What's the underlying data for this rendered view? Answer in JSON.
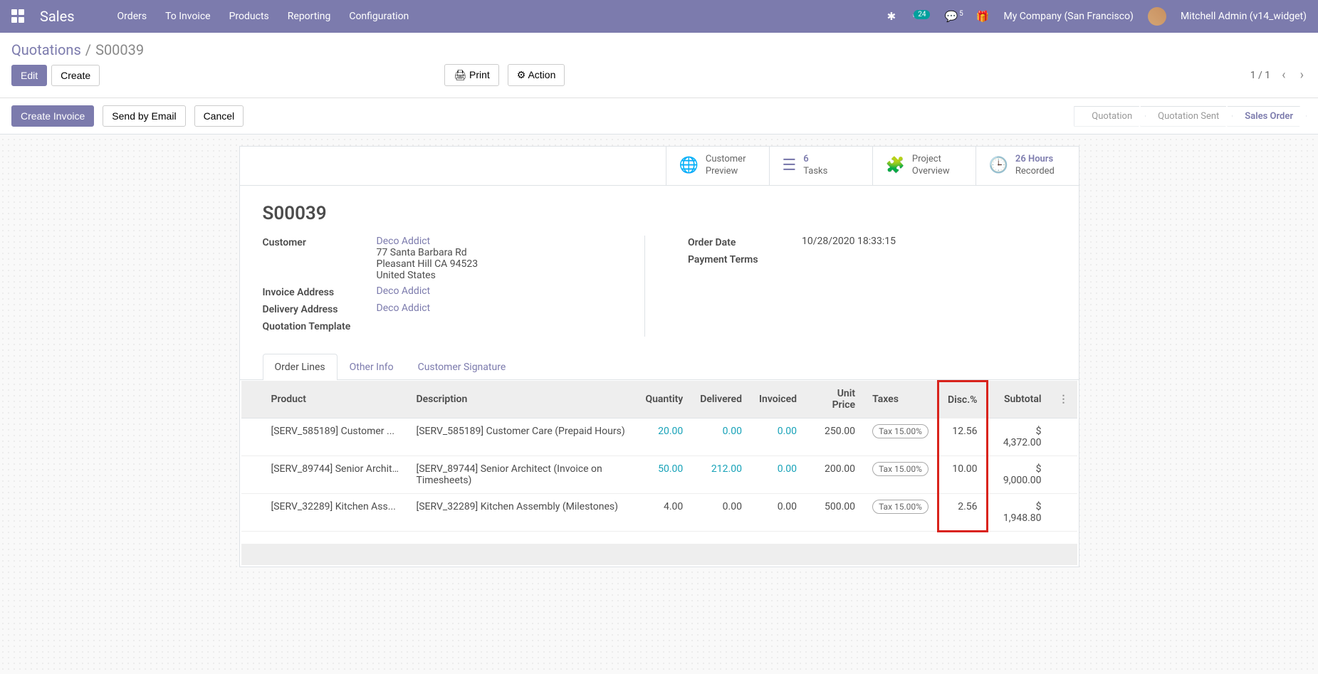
{
  "navbar": {
    "brand": "Sales",
    "items": [
      "Orders",
      "To Invoice",
      "Products",
      "Reporting",
      "Configuration"
    ],
    "clock_badge": "24",
    "chat_badge": "5",
    "company": "My Company (San Francisco)",
    "user": "Mitchell Admin (v14_widget)"
  },
  "breadcrumb": {
    "parent": "Quotations",
    "current": "S00039"
  },
  "action_buttons": {
    "edit": "Edit",
    "create": "Create",
    "print": "Print",
    "action": "Action"
  },
  "pager": {
    "text": "1 / 1"
  },
  "status_bar": {
    "create_invoice": "Create Invoice",
    "send_email": "Send by Email",
    "cancel": "Cancel",
    "steps": [
      "Quotation",
      "Quotation Sent",
      "Sales Order"
    ]
  },
  "stats": {
    "preview": {
      "l1": "Customer",
      "l2": "Preview"
    },
    "tasks": {
      "num": "6",
      "label": "Tasks"
    },
    "project": {
      "l1": "Project",
      "l2": "Overview"
    },
    "hours": {
      "l1": "26 Hours",
      "l2": "Recorded"
    }
  },
  "record": {
    "title": "S00039",
    "customer_label": "Customer",
    "customer_name": "Deco Addict",
    "customer_addr1": "77 Santa Barbara Rd",
    "customer_addr2": "Pleasant Hill CA 94523",
    "customer_addr3": "United States",
    "invoice_addr_label": "Invoice Address",
    "invoice_addr": "Deco Addict",
    "delivery_addr_label": "Delivery Address",
    "delivery_addr": "Deco Addict",
    "quote_tmpl_label": "Quotation Template",
    "order_date_label": "Order Date",
    "order_date": "10/28/2020 18:33:15",
    "payment_terms_label": "Payment Terms"
  },
  "tabs": [
    "Order Lines",
    "Other Info",
    "Customer Signature"
  ],
  "table": {
    "headers": {
      "product": "Product",
      "description": "Description",
      "quantity": "Quantity",
      "delivered": "Delivered",
      "invoiced": "Invoiced",
      "unit_price": "Unit Price",
      "taxes": "Taxes",
      "disc": "Disc.%",
      "subtotal": "Subtotal"
    },
    "rows": [
      {
        "product": "[SERV_585189] Customer ...",
        "description": "[SERV_585189] Customer Care (Prepaid Hours)",
        "quantity": "20.00",
        "delivered": "0.00",
        "invoiced": "0.00",
        "unit_price": "250.00",
        "taxes": "Tax 15.00%",
        "disc": "12.56",
        "subtotal": "$ 4,372.00",
        "qty_link": true,
        "del_link": true,
        "inv_link": true
      },
      {
        "product": "[SERV_89744] Senior Archit...",
        "description": "[SERV_89744] Senior Architect (Invoice on Timesheets)",
        "quantity": "50.00",
        "delivered": "212.00",
        "invoiced": "0.00",
        "unit_price": "200.00",
        "taxes": "Tax 15.00%",
        "disc": "10.00",
        "subtotal": "$ 9,000.00",
        "qty_link": true,
        "del_link": true,
        "inv_link": true
      },
      {
        "product": "[SERV_32289] Kitchen Ass...",
        "description": "[SERV_32289] Kitchen Assembly (Milestones)",
        "quantity": "4.00",
        "delivered": "0.00",
        "invoiced": "0.00",
        "unit_price": "500.00",
        "taxes": "Tax 15.00%",
        "disc": "2.56",
        "subtotal": "$ 1,948.80",
        "qty_link": false,
        "del_link": false,
        "inv_link": false
      }
    ]
  }
}
